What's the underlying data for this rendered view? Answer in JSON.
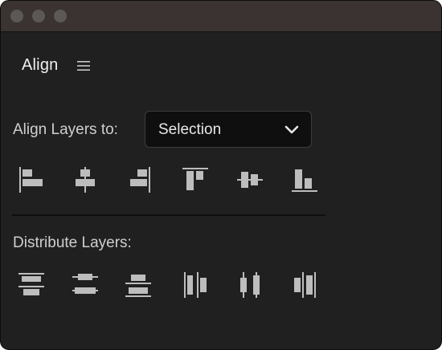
{
  "panel": {
    "title": "Align",
    "menu_icon": "hamburger-menu-icon"
  },
  "align": {
    "label": "Align Layers to:",
    "dropdown_value": "Selection",
    "buttons": [
      {
        "name": "align-left-edges",
        "icon": "align-left-icon"
      },
      {
        "name": "align-horizontal-centers",
        "icon": "align-horizontal-center-icon"
      },
      {
        "name": "align-right-edges",
        "icon": "align-right-icon"
      },
      {
        "name": "align-top-edges",
        "icon": "align-top-icon"
      },
      {
        "name": "align-vertical-centers",
        "icon": "align-vertical-center-icon"
      },
      {
        "name": "align-bottom-edges",
        "icon": "align-bottom-icon"
      }
    ]
  },
  "distribute": {
    "label": "Distribute Layers:",
    "buttons": [
      {
        "name": "distribute-top-edges",
        "icon": "distribute-top-icon"
      },
      {
        "name": "distribute-vertical-centers",
        "icon": "distribute-vertical-center-icon"
      },
      {
        "name": "distribute-bottom-edges",
        "icon": "distribute-bottom-icon"
      },
      {
        "name": "distribute-left-edges",
        "icon": "distribute-left-icon"
      },
      {
        "name": "distribute-horizontal-centers",
        "icon": "distribute-horizontal-center-icon"
      },
      {
        "name": "distribute-right-edges",
        "icon": "distribute-right-icon"
      }
    ]
  },
  "colors": {
    "panel_bg": "#202020",
    "titlebar_bg": "#3a3331",
    "icon": "#bdbdbd",
    "text": "#cfcfcf"
  }
}
